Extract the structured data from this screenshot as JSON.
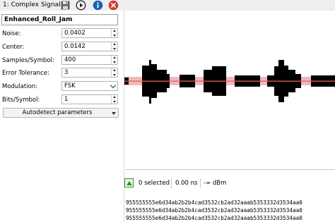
{
  "titlebar": {
    "title": "1: Complex Signal",
    "buttons": [
      {
        "name": "save-icon"
      },
      {
        "name": "play-icon"
      },
      {
        "name": "info-icon"
      },
      {
        "name": "close-icon"
      }
    ]
  },
  "signal_name": "Enhanced_Roll_Jam",
  "form": {
    "noise": {
      "label": "Noise:",
      "value": "0.0402"
    },
    "center": {
      "label": "Center:",
      "value": "0.0142"
    },
    "samples_per_symbol": {
      "label": "Samples/Symbol:",
      "value": "400"
    },
    "error_tolerance": {
      "label": "Error Tolerance:",
      "value": "3"
    },
    "modulation": {
      "label": "Modulation:",
      "value": "FSK"
    },
    "bits_per_symbol": {
      "label": "Bits/Symbol:",
      "value": "1"
    }
  },
  "autodetect": {
    "label": "Autodetect parameters"
  },
  "status": {
    "selected": "0",
    "selected_label": "selected",
    "time": "0.00 ns",
    "power": "-∞ dBm"
  },
  "bits": [
    "955555555e6d34ab2b2b4cad3532cb2ad32aaab5353332d3534aa0",
    "955555555e6d34ab2b2b4cad3532cb2ad32aaab5353332d3534aa0",
    "955555555e6d34ab2b2b4cad3532cb2ad32aaab5353332d3534aa0"
  ],
  "colors": {
    "waveform": "#000000",
    "center_line": "#e06060",
    "center_band": "#f2b8b8",
    "play_blue": "#1f5fb5",
    "close_red": "#d03a2a"
  }
}
